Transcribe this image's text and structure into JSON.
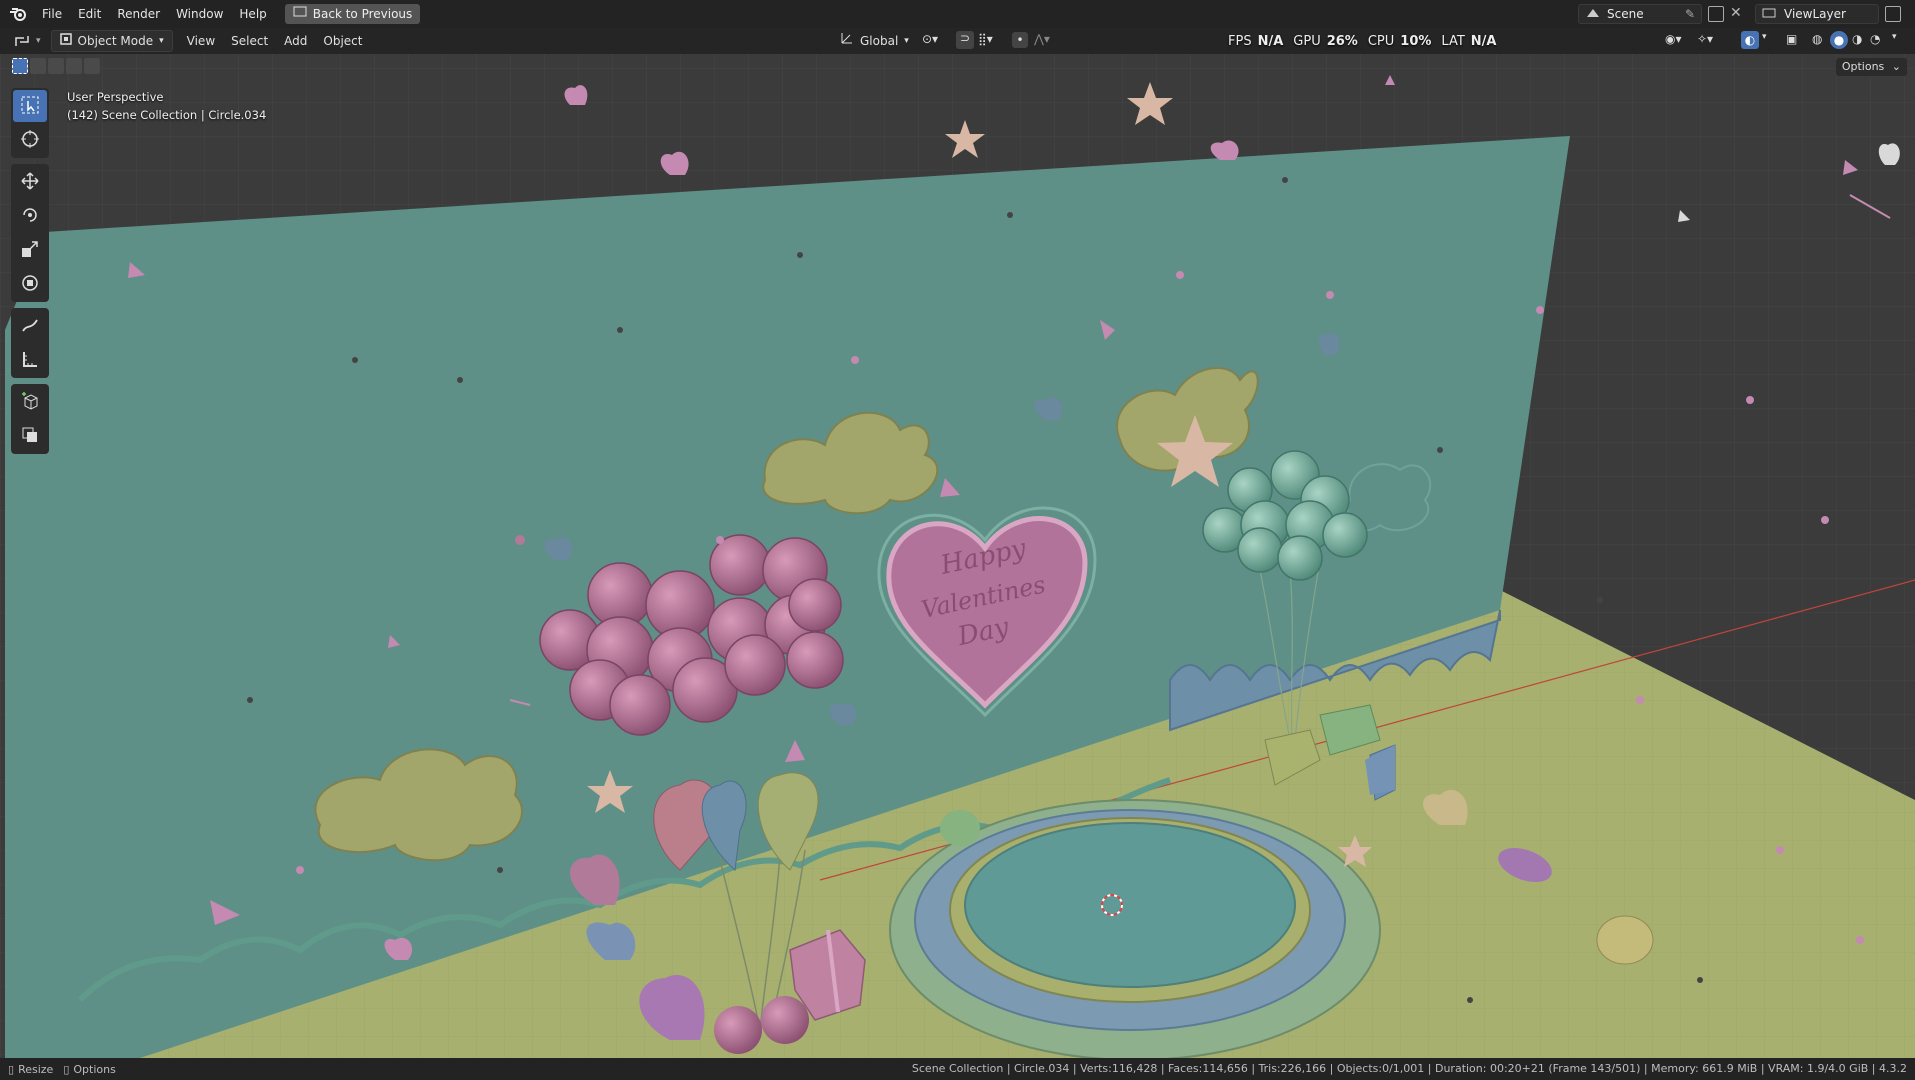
{
  "menubar": {
    "file": "File",
    "edit": "Edit",
    "render": "Render",
    "window": "Window",
    "help": "Help",
    "back": "Back to Previous",
    "scene": "Scene",
    "view_layer": "ViewLayer"
  },
  "header": {
    "mode": "Object Mode",
    "view": "View",
    "select": "Select",
    "add": "Add",
    "object": "Object",
    "orientation": "Global",
    "options": "Options"
  },
  "stats": {
    "fps_label": "FPS",
    "fps_value": "N/A",
    "gpu_label": "GPU",
    "gpu_value": "26%",
    "cpu_label": "CPU",
    "cpu_value": "10%",
    "lat_label": "LAT",
    "lat_value": "N/A"
  },
  "viewport": {
    "perspective": "User Perspective",
    "collection_info": "(142) Scene Collection | Circle.034",
    "sign_text_1": "Happy",
    "sign_text_2": "Valentines",
    "sign_text_3": "Day"
  },
  "statusbar": {
    "resize": "Resize",
    "options": "Options",
    "info": "Scene Collection | Circle.034 | Verts:116,428 | Faces:114,656 | Tris:226,166 | Objects:0/1,001 | Duration: 00:20+21 (Frame 143/501) | Memory: 661.9 MiB | VRAM: 1.9/4.0 GiB | 4.3.2"
  },
  "colors": {
    "wall": "#5c8f86",
    "floor": "#a3ad6e",
    "bg": "#3a3a3a",
    "accent": "#4772b3"
  }
}
